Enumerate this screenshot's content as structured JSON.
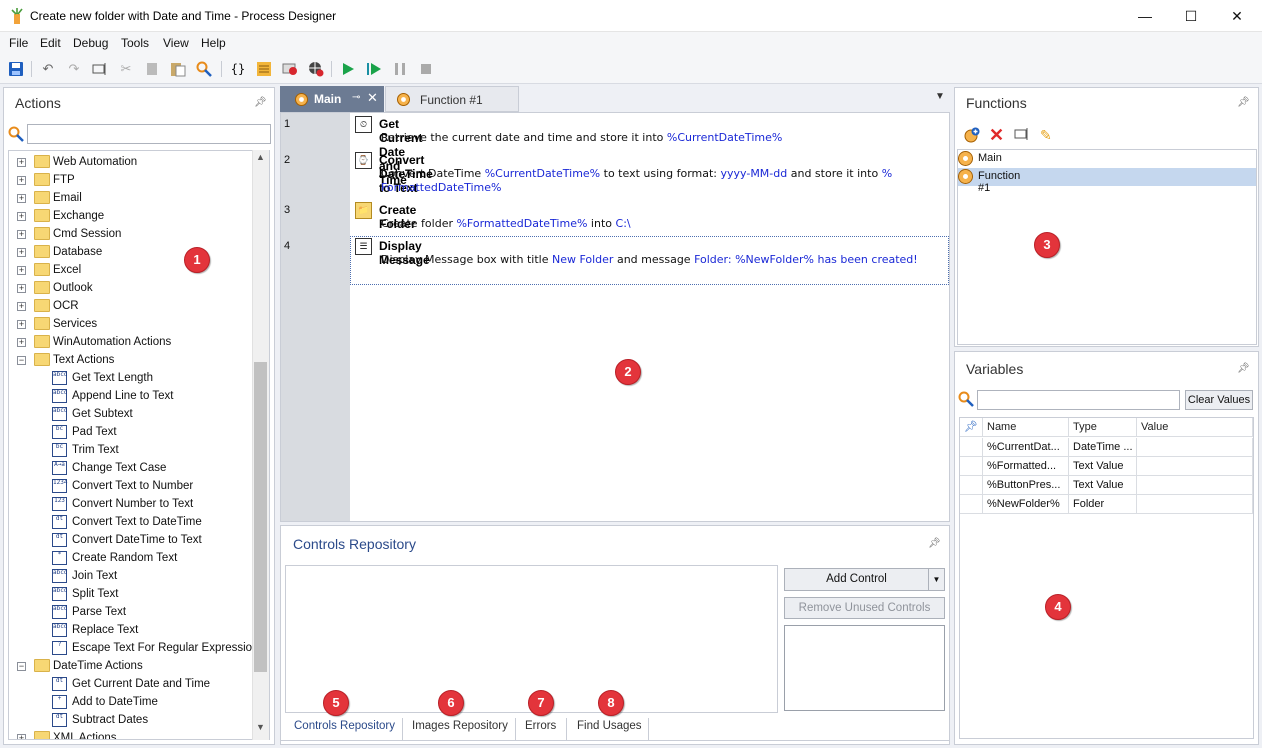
{
  "window": {
    "title": "Create new folder with Date and Time - Process Designer",
    "minimize": "—",
    "maximize": "☐",
    "close": "✕"
  },
  "menu": [
    "File",
    "Edit",
    "Debug",
    "Tools",
    "View",
    "Help"
  ],
  "toolbar": {
    "icons": [
      "save-icon",
      "undo-icon",
      "redo-icon",
      "rename-icon",
      "cut-icon",
      "copy-icon",
      "paste-icon",
      "find-icon",
      "braces-icon",
      "notes-icon",
      "record-icon",
      "web-recorder-icon",
      "run-icon",
      "run-next-icon",
      "pause-icon",
      "stop-icon"
    ],
    "braces_glyph": "{}"
  },
  "actions_panel": {
    "title": "Actions",
    "search_value": "",
    "tree": [
      {
        "kind": "folder",
        "label": "Web Automation",
        "expander": "+"
      },
      {
        "kind": "folder",
        "label": "FTP",
        "expander": "+"
      },
      {
        "kind": "folder",
        "label": "Email",
        "expander": "+"
      },
      {
        "kind": "folder",
        "label": "Exchange",
        "expander": "+"
      },
      {
        "kind": "folder",
        "label": "Cmd Session",
        "expander": "+"
      },
      {
        "kind": "folder",
        "label": "Database",
        "expander": "+"
      },
      {
        "kind": "folder",
        "label": "Excel",
        "expander": "+"
      },
      {
        "kind": "folder",
        "label": "Outlook",
        "expander": "+"
      },
      {
        "kind": "folder",
        "label": "OCR",
        "expander": "+"
      },
      {
        "kind": "folder",
        "label": "Services",
        "expander": "+"
      },
      {
        "kind": "folder",
        "label": "WinAutomation Actions",
        "expander": "+"
      },
      {
        "kind": "folder",
        "label": "Text Actions",
        "expander": "−"
      },
      {
        "kind": "leaf",
        "label": "Get Text Length",
        "icon": "abcd"
      },
      {
        "kind": "leaf",
        "label": "Append Line to Text",
        "icon": "abcd"
      },
      {
        "kind": "leaf",
        "label": "Get Subtext",
        "icon": "abcd"
      },
      {
        "kind": "leaf",
        "label": "Pad Text",
        "icon": "bc"
      },
      {
        "kind": "leaf",
        "label": "Trim Text",
        "icon": "bc"
      },
      {
        "kind": "leaf",
        "label": "Change Text Case",
        "icon": "A→a"
      },
      {
        "kind": "leaf",
        "label": "Convert Text to Number",
        "icon": "1234"
      },
      {
        "kind": "leaf",
        "label": "Convert Number to Text",
        "icon": "123"
      },
      {
        "kind": "leaf",
        "label": "Convert Text to DateTime",
        "icon": "dt"
      },
      {
        "kind": "leaf",
        "label": "Convert DateTime to Text",
        "icon": "dt"
      },
      {
        "kind": "leaf",
        "label": "Create Random Text",
        "icon": "*"
      },
      {
        "kind": "leaf",
        "label": "Join Text",
        "icon": "abcd"
      },
      {
        "kind": "leaf",
        "label": "Split Text",
        "icon": "abcd"
      },
      {
        "kind": "leaf",
        "label": "Parse Text",
        "icon": "abcd"
      },
      {
        "kind": "leaf",
        "label": "Replace Text",
        "icon": "abcd"
      },
      {
        "kind": "leaf",
        "label": "Escape Text For Regular Expression",
        "icon": "?"
      },
      {
        "kind": "folder",
        "label": "DateTime Actions",
        "expander": "−"
      },
      {
        "kind": "leaf",
        "label": "Get Current Date and Time",
        "icon": "dt"
      },
      {
        "kind": "leaf",
        "label": "Add to DateTime",
        "icon": "+"
      },
      {
        "kind": "leaf",
        "label": "Subtract Dates",
        "icon": "dt"
      },
      {
        "kind": "folder",
        "label": "XML Actions",
        "expander": "+"
      }
    ]
  },
  "editor": {
    "tabs": [
      {
        "label": "Main",
        "active": true
      },
      {
        "label": "Function #1",
        "active": false
      }
    ],
    "steps": [
      {
        "no": "1",
        "title": "Get Current Date and Time",
        "desc": [
          {
            "t": "Retrieve the current date and time and store it into "
          },
          {
            "t": "%CurrentDateTime%",
            "v": true
          }
        ]
      },
      {
        "no": "2",
        "title": "Convert DateTime to Text",
        "desc": [
          {
            "t": "Convert DateTime "
          },
          {
            "t": "%CurrentDateTime%",
            "v": true
          },
          {
            "t": " to text using format: "
          },
          {
            "t": "yyyy-MM-dd",
            "v": true
          },
          {
            "t": " and store it into "
          },
          {
            "t": "%",
            "v": true
          }
        ],
        "desc2": [
          {
            "t": "FormattedDateTime%",
            "v": true
          }
        ]
      },
      {
        "no": "3",
        "title": "Create Folder",
        "desc": [
          {
            "t": "Create folder "
          },
          {
            "t": "%FormattedDateTime%",
            "v": true
          },
          {
            "t": " into "
          },
          {
            "t": "C:\\",
            "v": true
          }
        ]
      },
      {
        "no": "4",
        "title": "Display Message",
        "desc": [
          {
            "t": "Display Message box with title "
          },
          {
            "t": "New Folder",
            "v": true
          },
          {
            "t": " and message "
          },
          {
            "t": "Folder: %NewFolder% has been created!",
            "v": true
          }
        ]
      }
    ]
  },
  "controls_repo": {
    "title": "Controls Repository",
    "add_control": "Add Control",
    "remove_unused": "Remove Unused Controls",
    "tabs": [
      "Controls Repository",
      "Images Repository",
      "Errors",
      "Find Usages"
    ]
  },
  "functions_panel": {
    "title": "Functions",
    "items": [
      {
        "label": "Main",
        "selected": false
      },
      {
        "label": "Function #1",
        "selected": true
      }
    ]
  },
  "variables_panel": {
    "title": "Variables",
    "search_value": "",
    "clear_values": "Clear Values",
    "columns": [
      "Name",
      "Type",
      "Value"
    ],
    "rows": [
      {
        "name": "%CurrentDat...",
        "type": "DateTime ...",
        "value": ""
      },
      {
        "name": "%Formatted...",
        "type": "Text Value",
        "value": ""
      },
      {
        "name": "%ButtonPres...",
        "type": "Text Value",
        "value": ""
      },
      {
        "name": "%NewFolder%",
        "type": "Folder",
        "value": ""
      }
    ]
  },
  "annotations": [
    "1",
    "2",
    "3",
    "4",
    "5",
    "6",
    "7",
    "8"
  ]
}
